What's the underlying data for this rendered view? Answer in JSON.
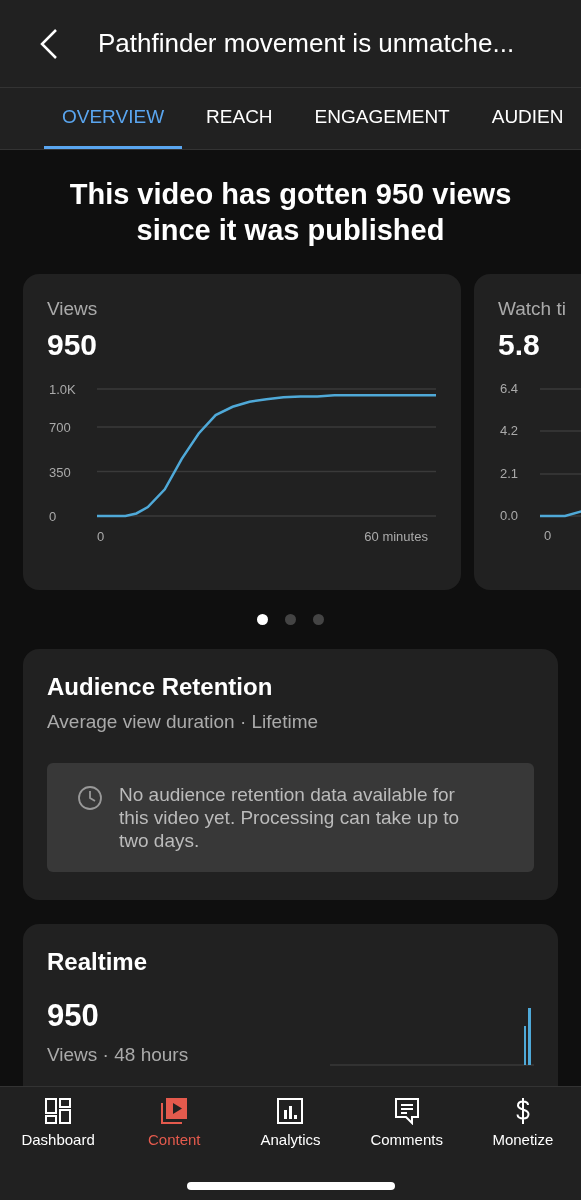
{
  "header": {
    "title": "Pathfinder movement is unmatche..."
  },
  "tabs": [
    {
      "label": "OVERVIEW",
      "selected": true
    },
    {
      "label": "REACH",
      "selected": false
    },
    {
      "label": "ENGAGEMENT",
      "selected": false
    },
    {
      "label": "AUDIEN",
      "selected": false
    }
  ],
  "headline": "This video has gotten 950 views since it was published",
  "metric_cards": [
    {
      "kind": "chart",
      "label": "Views",
      "value": "950",
      "chart_data": {
        "type": "line",
        "x": [
          0,
          3.4,
          5.7,
          6.8,
          7.9,
          10.2,
          13.6,
          17,
          20.4,
          23.8,
          27.2,
          30.6,
          34,
          37.4,
          40.8,
          44.2,
          47.6,
          51,
          56.7,
          62.3,
          68
        ],
        "series": [
          {
            "color": "#4fa9d8",
            "values": [
              0,
              0,
              0,
              10,
              20,
              70,
              210,
              450,
              650,
              795,
              860,
              900,
              920,
              935,
              940,
              940,
              950,
              950,
              950,
              950,
              950
            ]
          }
        ],
        "xlim": [
          0,
          68
        ],
        "ylim": [
          0,
          1000
        ],
        "xticks": [
          0,
          {
            "value": 60,
            "label": "60 minutes"
          }
        ],
        "yticks": [
          0,
          350,
          700,
          {
            "value": 1000,
            "label": "1.0K"
          }
        ]
      }
    },
    {
      "kind": "partial",
      "label": "Watch ti",
      "value": "5.8",
      "axis_labels": [
        "6.4",
        "4.2",
        "2.1",
        "0.0"
      ],
      "x_label": "0"
    }
  ],
  "pager": [
    {
      "selected": true
    },
    {
      "selected": false
    },
    {
      "selected": false
    }
  ],
  "retention": {
    "title": "Audience Retention",
    "subtitle": "Average view duration · Lifetime",
    "notice": "No audience retention data available for this video yet. Processing can take up to two days."
  },
  "realtime": {
    "title": "Realtime",
    "value": "950",
    "caption": "Views · 48 hours"
  },
  "nav": [
    {
      "label": "Dashboard",
      "kind": "dashboard",
      "selected": false
    },
    {
      "label": "Content",
      "kind": "content",
      "selected": true
    },
    {
      "label": "Analytics",
      "kind": "analytics",
      "selected": false
    },
    {
      "label": "Comments",
      "kind": "comments",
      "selected": false
    },
    {
      "label": "Monetize",
      "kind": "monetize",
      "selected": false
    }
  ]
}
